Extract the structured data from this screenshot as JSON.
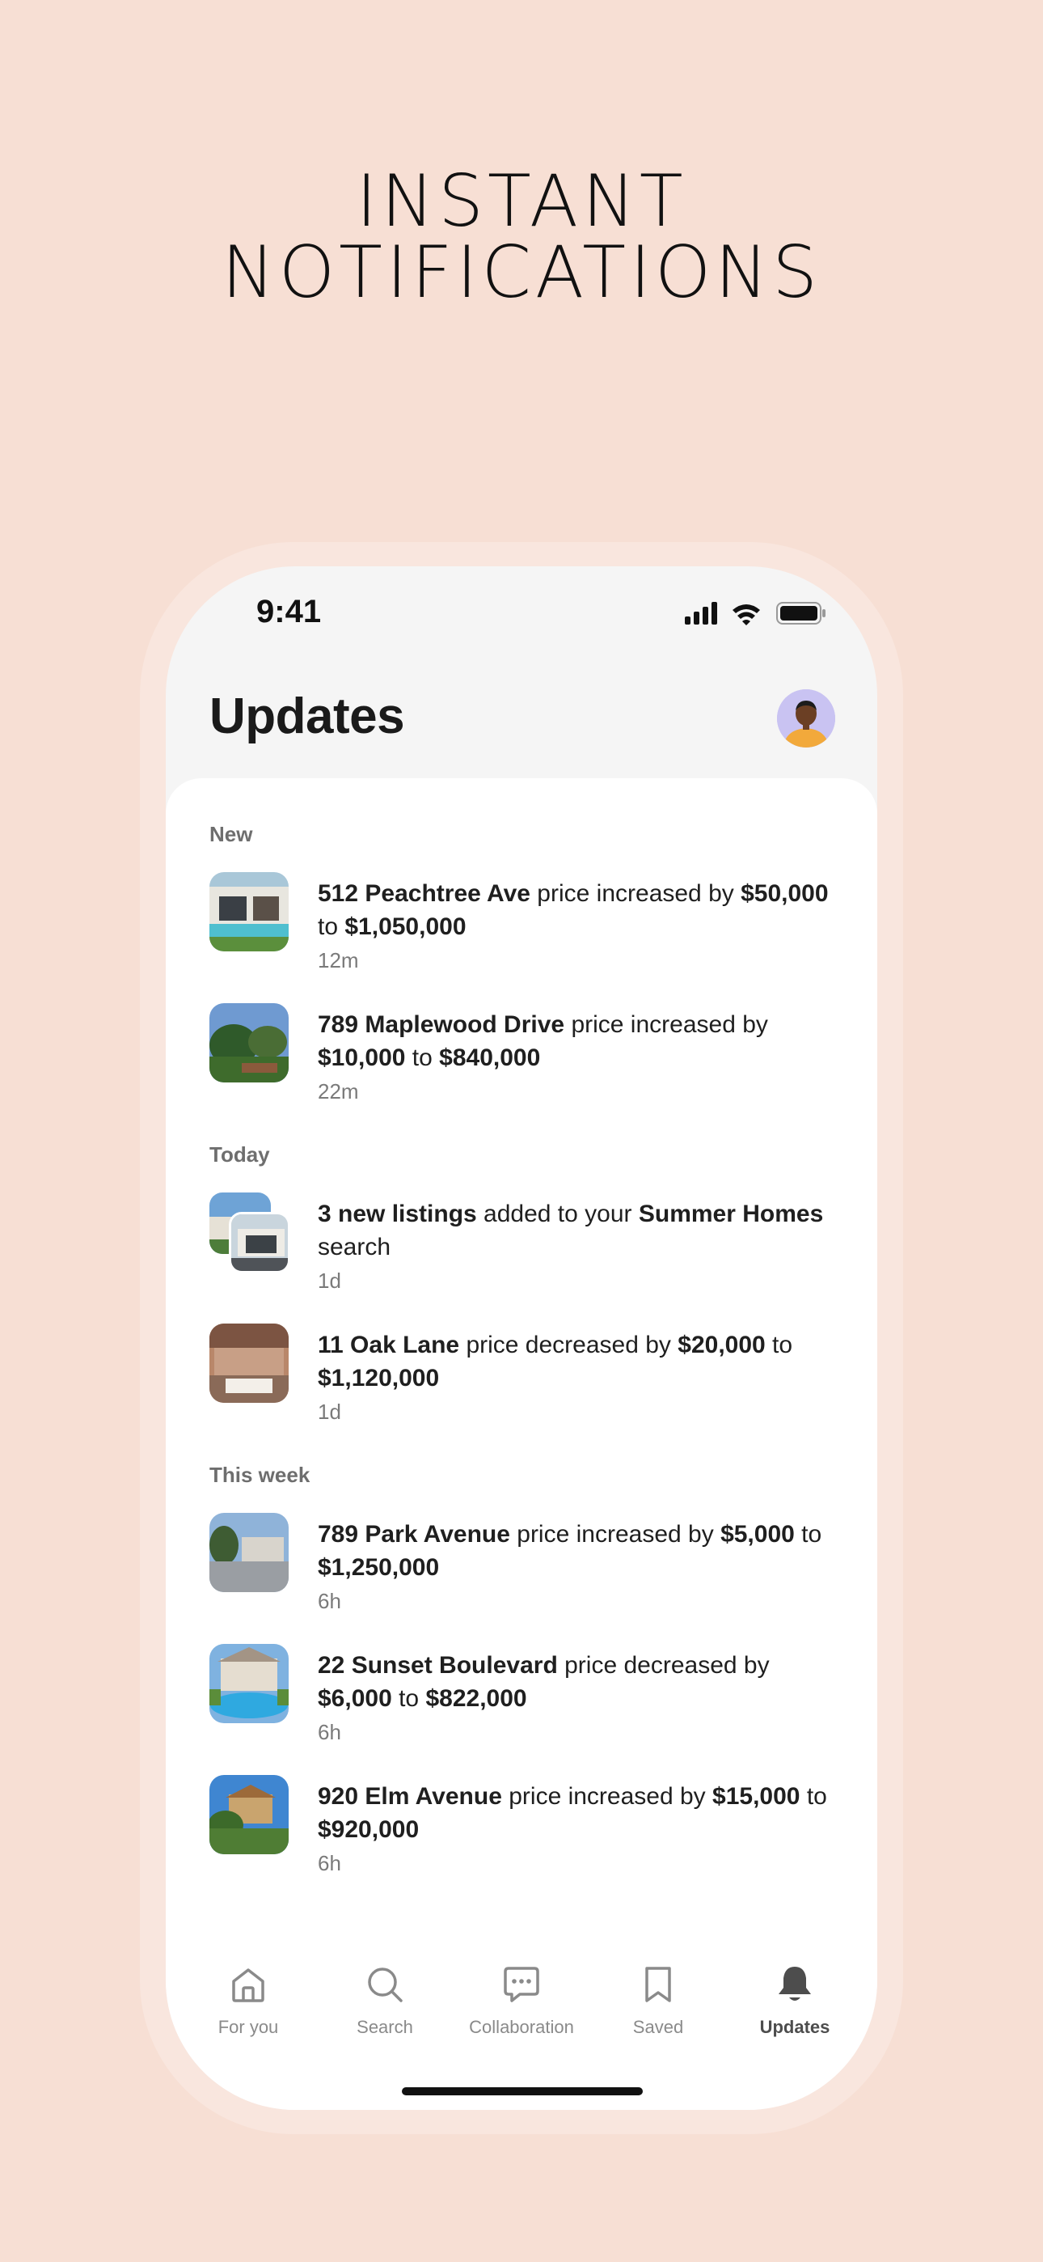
{
  "headline": {
    "line1": "INSTANT",
    "line2": "NOTIFICATIONS"
  },
  "status_bar": {
    "time": "9:41"
  },
  "header": {
    "title": "Updates"
  },
  "sections": {
    "new": "New",
    "today": "Today",
    "this_week": "This week"
  },
  "notifications": [
    {
      "b1": "512 Peachtree Ave",
      "t1": " price increased by ",
      "b2": "$50,000",
      "t2": " to ",
      "b3": "$1,050,000",
      "t3": "",
      "time": "12m"
    },
    {
      "b1": "789 Maplewood Drive",
      "t1": " price increased by ",
      "b2": "$10,000",
      "t2": " to ",
      "b3": "$840,000",
      "t3": "",
      "time": "22m"
    },
    {
      "b1": "3 new listings",
      "t1": " added to your ",
      "b2": "Summer Homes",
      "t2": " search",
      "b3": "",
      "t3": "",
      "time": "1d"
    },
    {
      "b1": "11 Oak Lane",
      "t1": " price decreased by ",
      "b2": "$20,000",
      "t2": " to ",
      "b3": "$1,120,000",
      "t3": "",
      "time": "1d"
    },
    {
      "b1": "789 Park Avenue",
      "t1": " price increased by ",
      "b2": "$5,000",
      "t2": " to ",
      "b3": "$1,250,000",
      "t3": "",
      "time": "6h"
    },
    {
      "b1": "22 Sunset Boulevard",
      "t1": " price decreased by ",
      "b2": "$6,000",
      "t2": " to ",
      "b3": "$822,000",
      "t3": "",
      "time": "6h"
    },
    {
      "b1": "920 Elm Avenue",
      "t1": " price increased by ",
      "b2": "$15,000",
      "t2": " to ",
      "b3": "$920,000",
      "t3": "",
      "time": "6h"
    }
  ],
  "tabbar": {
    "for_you": "For you",
    "search": "Search",
    "collaboration": "Collaboration",
    "saved": "Saved",
    "updates": "Updates",
    "active": "updates"
  },
  "colors": {
    "background": "#f7dfd4",
    "phone_frame": "#f9e6de",
    "sheet": "#ffffff",
    "active_tab": "#4d4d4d",
    "inactive_tab": "#8a8a8a"
  },
  "icons": [
    "signal-icon",
    "wifi-icon",
    "battery-icon",
    "home-icon",
    "search-icon",
    "chat-icon",
    "bookmark-icon",
    "bell-icon"
  ]
}
